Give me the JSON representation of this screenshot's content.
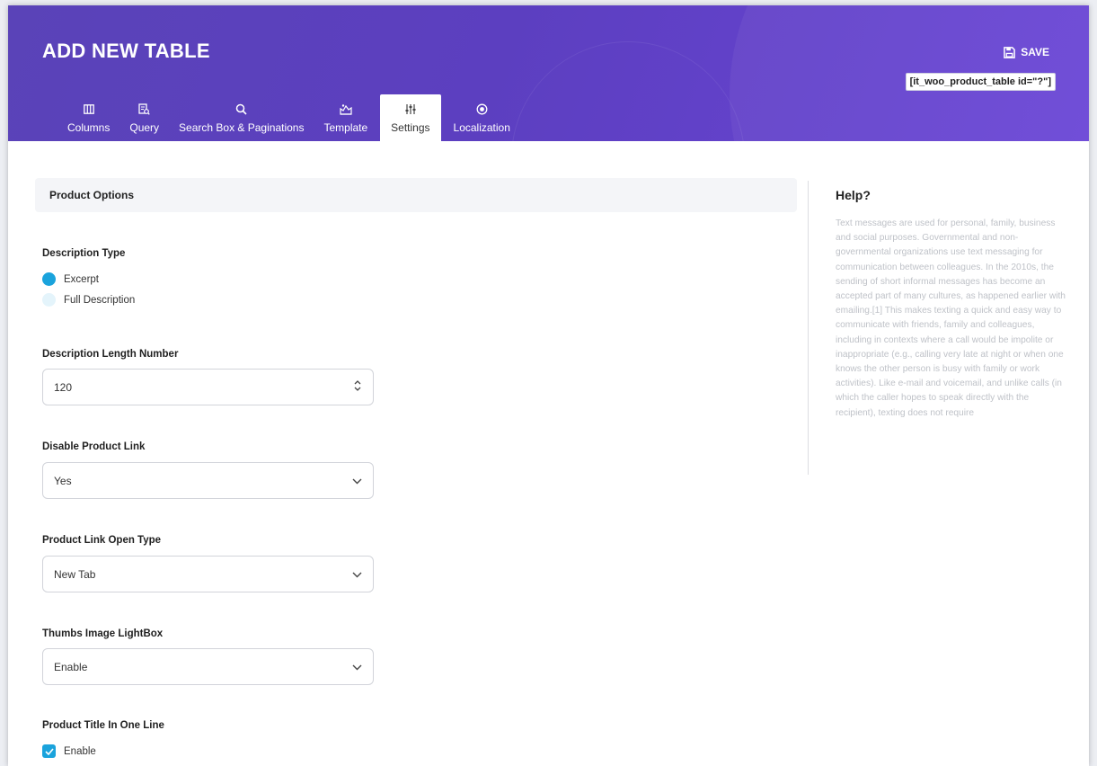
{
  "header": {
    "title": "ADD NEW TABLE",
    "save_label": "SAVE",
    "shortcode": "[it_woo_product_table id=\"?\"]"
  },
  "tabs": [
    {
      "label": "Columns",
      "icon": "columns-icon"
    },
    {
      "label": "Query",
      "icon": "query-icon"
    },
    {
      "label": "Search Box & Paginations",
      "icon": "search-icon"
    },
    {
      "label": "Template",
      "icon": "template-icon"
    },
    {
      "label": "Settings",
      "icon": "sliders-icon",
      "active": true
    },
    {
      "label": "Localization",
      "icon": "target-icon"
    }
  ],
  "section": {
    "title": "Product Options"
  },
  "fields": {
    "description_type": {
      "label": "Description Type",
      "options": [
        "Excerpt",
        "Full Description"
      ],
      "selected": "Excerpt"
    },
    "description_length": {
      "label": "Description Length Number",
      "value": "120"
    },
    "disable_product_link": {
      "label": "Disable Product Link",
      "value": "Yes"
    },
    "product_link_open_type": {
      "label": "Product Link Open Type",
      "value": "New Tab"
    },
    "thumbs_lightbox": {
      "label": "Thumbs Image LightBox",
      "value": "Enable"
    },
    "title_one_line": {
      "label": "Product Title In One Line",
      "checkbox_label": "Enable",
      "checked": true
    }
  },
  "help": {
    "title": "Help?",
    "text": "Text messages are used for personal, family, business and social purposes. Governmental and non-governmental organizations use text messaging for communication between colleagues. In the 2010s, the sending of short informal messages has become an accepted part of many cultures, as happened earlier with emailing.[1] This makes texting a quick and easy way to communicate with friends, family and colleagues, including in contexts where a call would be impolite or inappropriate (e.g., calling very late at night or when one knows the other person is busy with family or work activities). Like e-mail and voicemail, and unlike calls (in which the caller hopes to speak directly with the recipient), texting does not require"
  },
  "colors": {
    "header_purple": "#5c3fc0",
    "accent_blue": "#1aa3dc"
  }
}
